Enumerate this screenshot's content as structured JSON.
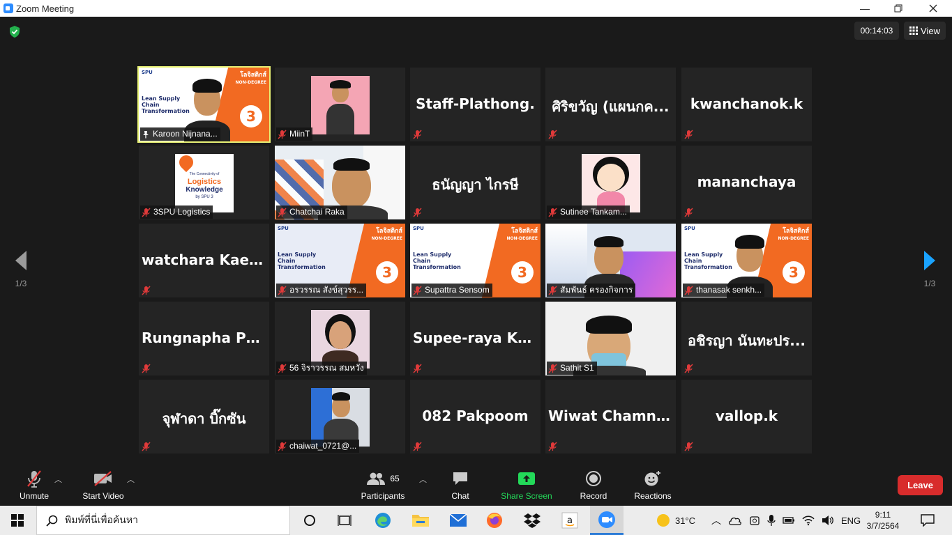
{
  "window": {
    "title": "Zoom Meeting"
  },
  "meeting": {
    "timer": "00:14:03",
    "view_label": "View"
  },
  "pager": {
    "left": "1/3",
    "right": "1/3"
  },
  "tiles": [
    {
      "type": "video",
      "label": "Karoon Nijnana...",
      "pinned": true,
      "active": true
    },
    {
      "type": "video",
      "label": "MiinT"
    },
    {
      "type": "name",
      "display": "Staff-Plathong.",
      "label": ""
    },
    {
      "type": "name",
      "display": "ศิริขวัญ (แผนกค...",
      "label": ""
    },
    {
      "type": "name",
      "display": "kwanchanok.k",
      "label": ""
    },
    {
      "type": "video",
      "label": "3SPU Logistics",
      "logo_text": [
        "The Connectivity of",
        "Logistics",
        "Knowledge",
        "by SPU 3"
      ]
    },
    {
      "type": "video",
      "label": "Chatchai Raka"
    },
    {
      "type": "name",
      "display": "ธนัญญา ไกรษี",
      "label": ""
    },
    {
      "type": "video",
      "label": "Sutinee Tankam..."
    },
    {
      "type": "name",
      "display": "mananchaya",
      "label": ""
    },
    {
      "type": "name",
      "display": "watchara  Kaewt...",
      "label": ""
    },
    {
      "type": "video",
      "label": "อรวรรณ สังข์สุวรร..."
    },
    {
      "type": "video",
      "label": "Supattra Sensom"
    },
    {
      "type": "video",
      "label": "สัมพันธ์ ครองกิจการ"
    },
    {
      "type": "video",
      "label": "thanasak senkh..."
    },
    {
      "type": "name",
      "display": "Rungnapha  Pon...",
      "label": ""
    },
    {
      "type": "video",
      "label": "56 จิราวรรณ สมหวัง"
    },
    {
      "type": "name",
      "display": "Supee-raya  Krit...",
      "label": ""
    },
    {
      "type": "video",
      "label": "Sathit S1"
    },
    {
      "type": "name",
      "display": "อชิรญา  นันทะปร...",
      "label": ""
    },
    {
      "type": "name",
      "display": "จุฬาดา บิ๊กซัน",
      "label": ""
    },
    {
      "type": "video",
      "label": "chaiwat_0721@..."
    },
    {
      "type": "name",
      "display": "082 Pakpoom",
      "label": ""
    },
    {
      "type": "name",
      "display": "Wiwat   Chamna...",
      "label": ""
    },
    {
      "type": "name",
      "display": "vallop.k",
      "label": ""
    }
  ],
  "slide": {
    "brand": "SPU",
    "title_th": "โลจิสติกส์",
    "subtitle": "NON-DEGREE",
    "course": "Lean Supply Chain Transformation",
    "cohort": "3"
  },
  "toolbar": {
    "unmute": "Unmute",
    "start_video": "Start Video",
    "participants": "Participants",
    "participants_count": "65",
    "chat": "Chat",
    "share_screen": "Share Screen",
    "record": "Record",
    "reactions": "Reactions",
    "leave": "Leave"
  },
  "taskbar": {
    "search_placeholder": "พิมพ์ที่นี่เพื่อค้นหา",
    "weather": "31°C",
    "lang": "ENG",
    "time": "9:11",
    "date": "3/7/2564"
  },
  "colors": {
    "active_outline": "#e8f275",
    "share_green": "#23d959",
    "leave_red": "#d82c2c",
    "next_arrow": "#1aa3ff"
  }
}
